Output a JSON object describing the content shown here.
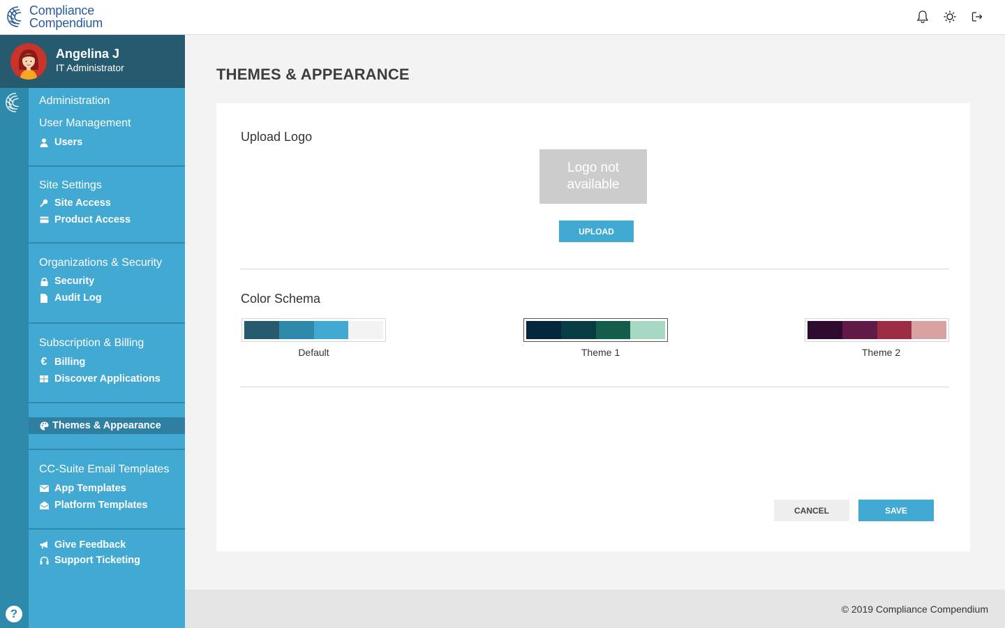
{
  "app": {
    "brand_line1": "Compliance",
    "brand_line2": "Compendium",
    "header_icons": [
      "bell-icon",
      "sun-icon",
      "logout-icon"
    ]
  },
  "profile": {
    "name": "Angelina J",
    "role": "IT Administrator"
  },
  "sidebar": {
    "administration": {
      "title": "Administration",
      "subtitle": "User Management",
      "items": [
        {
          "label": "Users",
          "icon": "user-icon"
        }
      ]
    },
    "site_settings": {
      "title": "Site Settings",
      "items": [
        {
          "label": "Site Access",
          "icon": "key-icon"
        },
        {
          "label": "Product Access",
          "icon": "card-icon"
        }
      ]
    },
    "org_security": {
      "title": "Organizations & Security",
      "items": [
        {
          "label": "Security",
          "icon": "lock-icon"
        },
        {
          "label": "Audit Log",
          "icon": "document-icon"
        }
      ]
    },
    "subscription": {
      "title": "Subscription & Billing",
      "items": [
        {
          "label": "Billing",
          "icon": "euro-icon"
        },
        {
          "label": "Discover Applications",
          "icon": "grid-icon"
        }
      ]
    },
    "themes": {
      "items": [
        {
          "label": "Themes & Appearance",
          "icon": "palette-icon",
          "active": true
        }
      ]
    },
    "email_templates": {
      "title": "CC-Suite Email Templates",
      "items": [
        {
          "label": "App Templates",
          "icon": "envelope-icon"
        },
        {
          "label": "Platform Templates",
          "icon": "envelope-open-icon"
        }
      ]
    },
    "support": {
      "items": [
        {
          "label": "Give Feedback",
          "icon": "megaphone-icon"
        },
        {
          "label": "Support Ticketing",
          "icon": "headset-icon"
        }
      ]
    },
    "help_label": "?"
  },
  "main": {
    "page_title": "THEMES & APPEARANCE",
    "upload_logo_label": "Upload Logo",
    "logo_placeholder": "Logo not available",
    "upload_button": "UPLOAD",
    "color_schema_label": "Color Schema",
    "themes": [
      {
        "name": "Default",
        "colors": [
          "#265a6e",
          "#2e8aab",
          "#41a9d2",
          "#f3f3f3"
        ],
        "selected": false
      },
      {
        "name": "Theme 1",
        "colors": [
          "#04263c",
          "#073d42",
          "#145c4c",
          "#a6d8c4"
        ],
        "selected": true
      },
      {
        "name": "Theme 2",
        "colors": [
          "#2f0a30",
          "#611a47",
          "#9c2d44",
          "#d9a2a2"
        ],
        "selected": false
      }
    ],
    "cancel_button": "CANCEL",
    "save_button": "SAVE"
  },
  "footer": {
    "copyright": "© 2019 Compliance Compendium"
  }
}
